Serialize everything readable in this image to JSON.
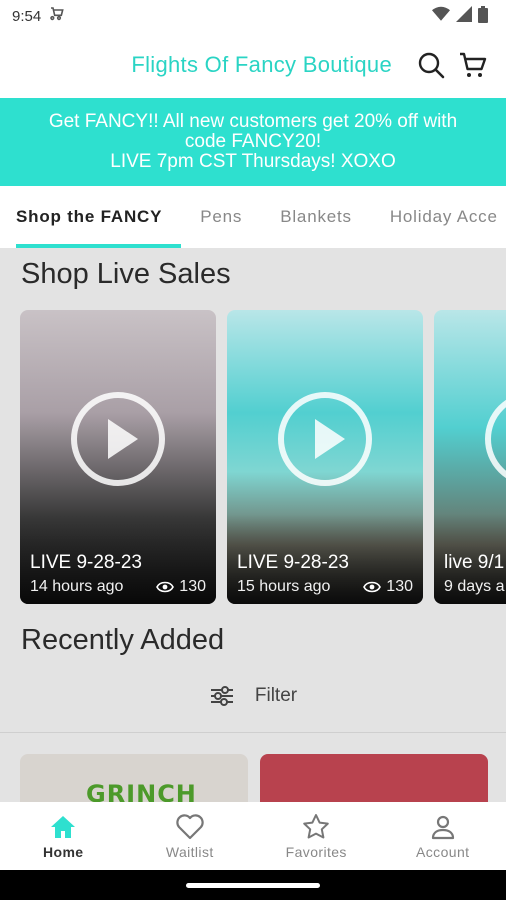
{
  "status": {
    "time": "9:54"
  },
  "header": {
    "store_title": "Flights Of Fancy Boutique"
  },
  "banner": {
    "line1": "Get FANCY!! All new customers get 20% off with",
    "line2": "code FANCY20!",
    "line3": "LIVE 7pm CST Thursdays! XOXO"
  },
  "tabs": [
    {
      "label": "Shop the FANCY",
      "active": true
    },
    {
      "label": "Pens"
    },
    {
      "label": "Blankets"
    },
    {
      "label": "Holiday Acce"
    }
  ],
  "live_sales": {
    "title": "Shop Live Sales",
    "cards": [
      {
        "title": "LIVE 9-28-23",
        "time": "14 hours ago",
        "views": "130"
      },
      {
        "title": "LIVE 9-28-23",
        "time": "15 hours ago",
        "views": "130"
      },
      {
        "title": "live 9/1",
        "time": "9 days a",
        "views": ""
      }
    ]
  },
  "recently_added": {
    "title": "Recently Added",
    "filter_label": "Filter",
    "product1_text": "GRINCH"
  },
  "nav": [
    {
      "label": "Home",
      "active": true
    },
    {
      "label": "Waitlist"
    },
    {
      "label": "Favorites"
    },
    {
      "label": "Account"
    }
  ],
  "colors": {
    "accent": "#2ee0cf",
    "title": "#2ad4c4"
  }
}
